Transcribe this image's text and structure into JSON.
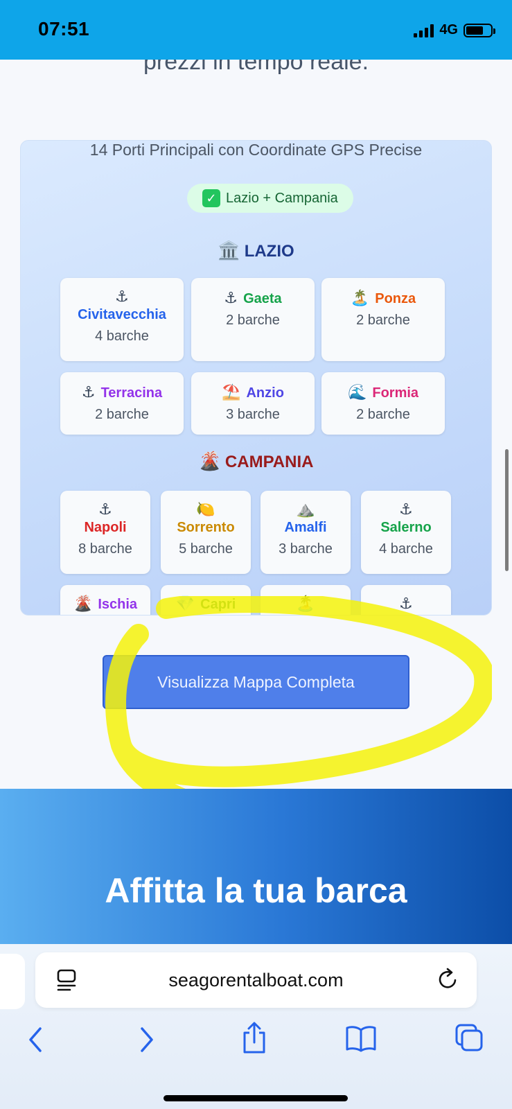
{
  "status_bar": {
    "time": "07:51",
    "network": "4G"
  },
  "hero": {
    "text_tail": "prezzi in tempo reale."
  },
  "ports": {
    "title": "14 Porti Principali con Coordinate GPS Precise",
    "chip_label": "Lazio + Campania",
    "lazio": {
      "heading": "LAZIO",
      "icon": "🏛️",
      "color": "#1e3a8a",
      "items": [
        {
          "icon": "⚓",
          "name": "Civitavecchia",
          "boats": "4 barche",
          "color": "#2563eb"
        },
        {
          "icon": "⚓",
          "name": "Gaeta",
          "boats": "2 barche",
          "color": "#16a34a"
        },
        {
          "icon": "🏝️",
          "name": "Ponza",
          "boats": "2 barche",
          "color": "#ea580c"
        },
        {
          "icon": "⚓",
          "name": "Terracina",
          "boats": "2 barche",
          "color": "#9333ea"
        },
        {
          "icon": "⛱️",
          "name": "Anzio",
          "boats": "3 barche",
          "color": "#4f46e5"
        },
        {
          "icon": "🌊",
          "name": "Formia",
          "boats": "2 barche",
          "color": "#db2777"
        }
      ]
    },
    "campania": {
      "heading": "CAMPANIA",
      "icon": "🌋",
      "color": "#991b1b",
      "items": [
        {
          "icon": "⚓",
          "name": "Napoli",
          "boats": "8 barche",
          "color": "#dc2626"
        },
        {
          "icon": "🍋",
          "name": "Sorrento",
          "boats": "5 barche",
          "color": "#ca8a04"
        },
        {
          "icon": "⛰️",
          "name": "Amalfi",
          "boats": "3 barche",
          "color": "#2563eb"
        },
        {
          "icon": "⚓",
          "name": "Salerno",
          "boats": "4 barche",
          "color": "#16a34a"
        },
        {
          "icon": "🌋",
          "name": "Ischia",
          "boats": "",
          "color": "#9333ea"
        },
        {
          "icon": "💎",
          "name": "Capri",
          "boats": "",
          "color": "#15803d"
        },
        {
          "icon": "🏝️",
          "name": "",
          "boats": "",
          "color": "#16a34a"
        },
        {
          "icon": "⚓",
          "name": "",
          "boats": "",
          "color": "#0f766e"
        }
      ]
    }
  },
  "cta": {
    "label": "Visualizza Mappa Completa"
  },
  "banner": {
    "title": "Affitta la tua barca"
  },
  "browser": {
    "url": "seagorentalboat.com"
  },
  "colors": {
    "status_bar": "#0ea5e9",
    "cta": "#4f7fea",
    "highlight": "#f5f20a"
  }
}
